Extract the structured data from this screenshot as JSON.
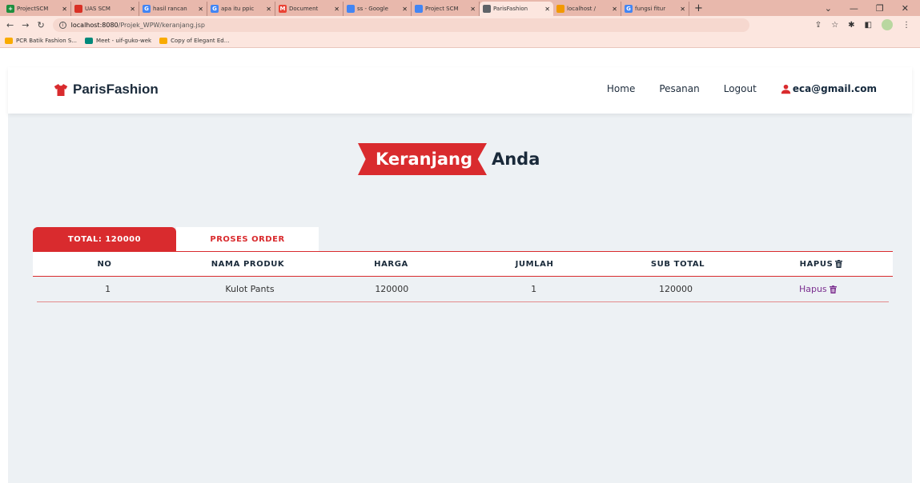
{
  "browser": {
    "tabs": [
      {
        "label": "ProjectSCM",
        "color": "#1e8e3e",
        "glyph": "+",
        "active": false
      },
      {
        "label": "UAS SCM",
        "color": "#d93025",
        "glyph": "",
        "active": false
      },
      {
        "label": "hasil rancan",
        "color": "#4285f4",
        "glyph": "G",
        "active": false
      },
      {
        "label": "apa itu ppic",
        "color": "#4285f4",
        "glyph": "G",
        "active": false
      },
      {
        "label": "Document",
        "color": "#ea4335",
        "glyph": "M",
        "active": false
      },
      {
        "label": "ss - Google",
        "color": "#4285f4",
        "glyph": "",
        "active": false
      },
      {
        "label": "Project SCM",
        "color": "#4285f4",
        "glyph": "",
        "active": false
      },
      {
        "label": "ParisFashion",
        "color": "#5f6368",
        "glyph": "",
        "active": true
      },
      {
        "label": "localhost /",
        "color": "#f29900",
        "glyph": "",
        "active": false
      },
      {
        "label": "fungsi fitur",
        "color": "#4285f4",
        "glyph": "G",
        "active": false
      }
    ],
    "url_host": "localhost:8080",
    "url_path": "/Projek_WPW/keranjang.jsp",
    "bookmarks": [
      {
        "label": "PCR Batik Fashion S...",
        "color": "#f9ab00"
      },
      {
        "label": "Meet - uif-guko-wek",
        "color": "#00897b"
      },
      {
        "label": "Copy of Elegant Ed...",
        "color": "#f9ab00"
      }
    ]
  },
  "navbar": {
    "brand": "ParisFashion",
    "home": "Home",
    "orders": "Pesanan",
    "logout": "Logout",
    "user_email": "eca@gmail.com"
  },
  "heading": {
    "highlight": "Keranjang",
    "rest": "Anda"
  },
  "tabs": {
    "total_label": "TOTAL: 120000",
    "order_label": "PROSES ORDER"
  },
  "table": {
    "headers": [
      "NO",
      "NAMA PRODUK",
      "HARGA",
      "JUMLAH",
      "SUB TOTAL",
      "HAPUS"
    ],
    "rows": [
      {
        "no": "1",
        "product": "Kulot Pants",
        "price": "120000",
        "qty": "1",
        "subtotal": "120000",
        "delete": "Hapus"
      }
    ]
  },
  "colors": {
    "accent": "#d92b2e",
    "dark": "#1a2a3a",
    "delete": "#7b2f8f",
    "page_bg": "#edf1f4"
  }
}
